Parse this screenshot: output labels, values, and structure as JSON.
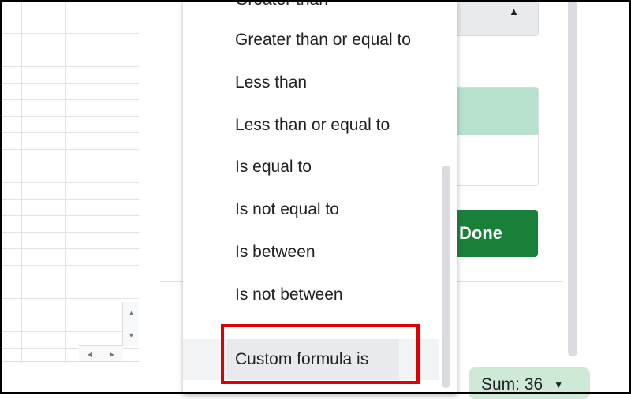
{
  "menu": {
    "items": [
      "Greater than",
      "Greater than or equal to",
      "Less than",
      "Less than or equal to",
      "Is equal to",
      "Is not equal to",
      "Is between",
      "Is not between",
      "Custom formula is"
    ],
    "highlighted_item": "Custom formula is"
  },
  "side_panel": {
    "done_label": "Done",
    "preview_fill_color": "#b7e1cd",
    "done_color": "#188038"
  },
  "status_bar": {
    "sum_label": "Sum: 36"
  },
  "annotation": {
    "highlight_color": "#e00000"
  },
  "icons": {
    "dropdown_arrow": "caret-up-icon",
    "sum_caret": "caret-down-icon",
    "scroll_up": "scroll-up-icon",
    "scroll_down": "scroll-down-icon",
    "scroll_left": "scroll-left-icon",
    "scroll_right": "scroll-right-icon"
  }
}
